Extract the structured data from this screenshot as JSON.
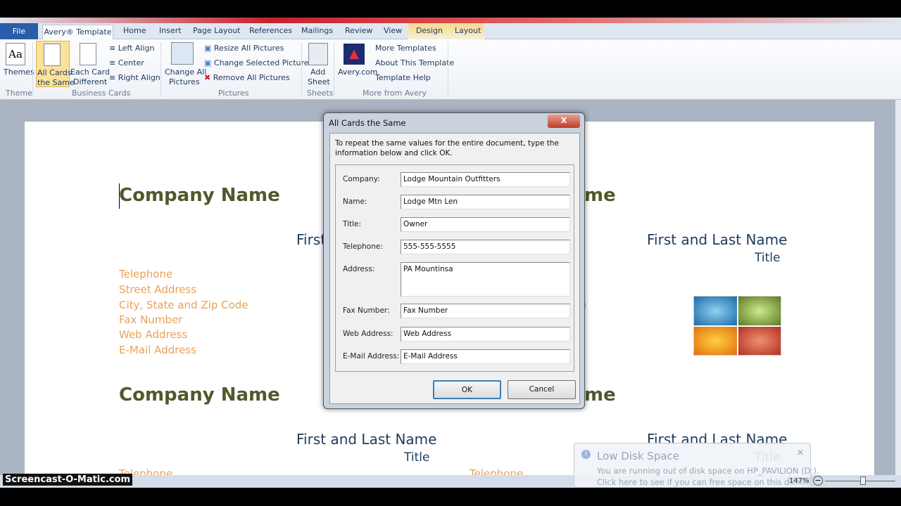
{
  "ribbon": {
    "tabs": [
      "File",
      "Avery® Template",
      "Home",
      "Insert",
      "Page Layout",
      "References",
      "Mailings",
      "Review",
      "View",
      "Design",
      "Layout"
    ],
    "themes": "Themes",
    "all_cards_1": "All Cards",
    "all_cards_2": "the Same",
    "each_card_1": "Each Card",
    "each_card_2": "Different",
    "left_align": "Left Align",
    "center": "Center",
    "right_align": "Right Align",
    "change_all_1": "Change All",
    "change_all_2": "Pictures",
    "resize_all": "Resize All Pictures",
    "change_selected": "Change Selected Picture",
    "remove_all": "Remove All Pictures",
    "add_sheet_1": "Add",
    "add_sheet_2": "Sheet",
    "avery_com": "Avery.com",
    "more_templates": "More Templates",
    "about": "About This Template",
    "help": "Template Help",
    "groups": [
      "Theme",
      "Business Cards",
      "Pictures",
      "Sheets",
      "More from Avery"
    ]
  },
  "document": {
    "company": "Company Name",
    "name": "First and Last Name",
    "title": "Title",
    "partial_company": "me",
    "partial_name": "First",
    "contact": [
      "Telephone",
      "Street Address",
      "City, State and Zip Code",
      "Fax Number",
      "Web Address",
      "E-Mail Address"
    ],
    "partial_le": "le"
  },
  "dialog": {
    "title": "All Cards the Same",
    "close": "X",
    "instructions": "To repeat the same values for the entire document, type the information below and click OK.",
    "fields": [
      {
        "label": "Company:",
        "value": "Lodge Mountain Outfitters"
      },
      {
        "label": "Name:",
        "value": "Lodge Mtn Len"
      },
      {
        "label": "Title:",
        "value": "Owner"
      },
      {
        "label": "Telephone:",
        "value": "555-555-5555"
      },
      {
        "label": "Address:",
        "value": "PA Mountinsa"
      },
      {
        "label": "Fax Number:",
        "value": "Fax Number"
      },
      {
        "label": "Web Address:",
        "value": "Web Address"
      },
      {
        "label": "E-Mail Address:",
        "value": "E-Mail Address"
      }
    ],
    "ok": "OK",
    "cancel": "Cancel"
  },
  "notification": {
    "title": "Low Disk Space",
    "line1": "You are running out of disk space on HP_PAVILION (D:).",
    "line2": "Click here to see if you can free space on this drive."
  },
  "status": {
    "zoom": "147%"
  },
  "watermark": "Screencast-O-Matic.com",
  "colors": {
    "company": "#4f5a2b",
    "name": "#1f3b5a",
    "contact": "#e8a25a",
    "file_tab": "#2a5ea8"
  }
}
